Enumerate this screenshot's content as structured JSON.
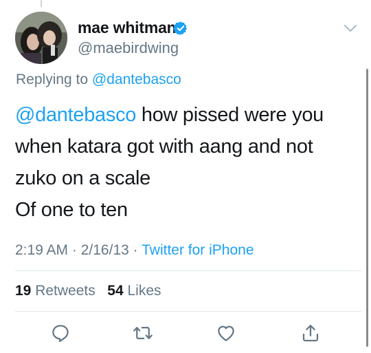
{
  "user": {
    "display_name": "mae whitman",
    "handle": "@maebirdwing",
    "verified": true
  },
  "reply": {
    "prefix": "Replying to",
    "to": "@dantebasco"
  },
  "tweet": {
    "mention": "@dantebasco",
    "line1_rest": " how pissed were you",
    "line2": "when katara got with aang and not",
    "line3": "zuko on a scale",
    "line4": "Of one to ten"
  },
  "meta": {
    "time": "2:19 AM",
    "sep1": " · ",
    "date": "2/16/13",
    "sep2": " · ",
    "source": "Twitter for iPhone"
  },
  "stats": {
    "retweets_count": "19",
    "retweets_label": "Retweets",
    "likes_count": "54",
    "likes_label": "Likes"
  },
  "colors": {
    "accent": "#1da1f2",
    "secondary_text": "#657786",
    "primary_text": "#14171a",
    "divider": "#e1e8ed"
  },
  "icons": [
    "verified-badge-icon",
    "chevron-down-icon",
    "reply-icon",
    "retweet-icon",
    "like-icon",
    "share-icon"
  ]
}
